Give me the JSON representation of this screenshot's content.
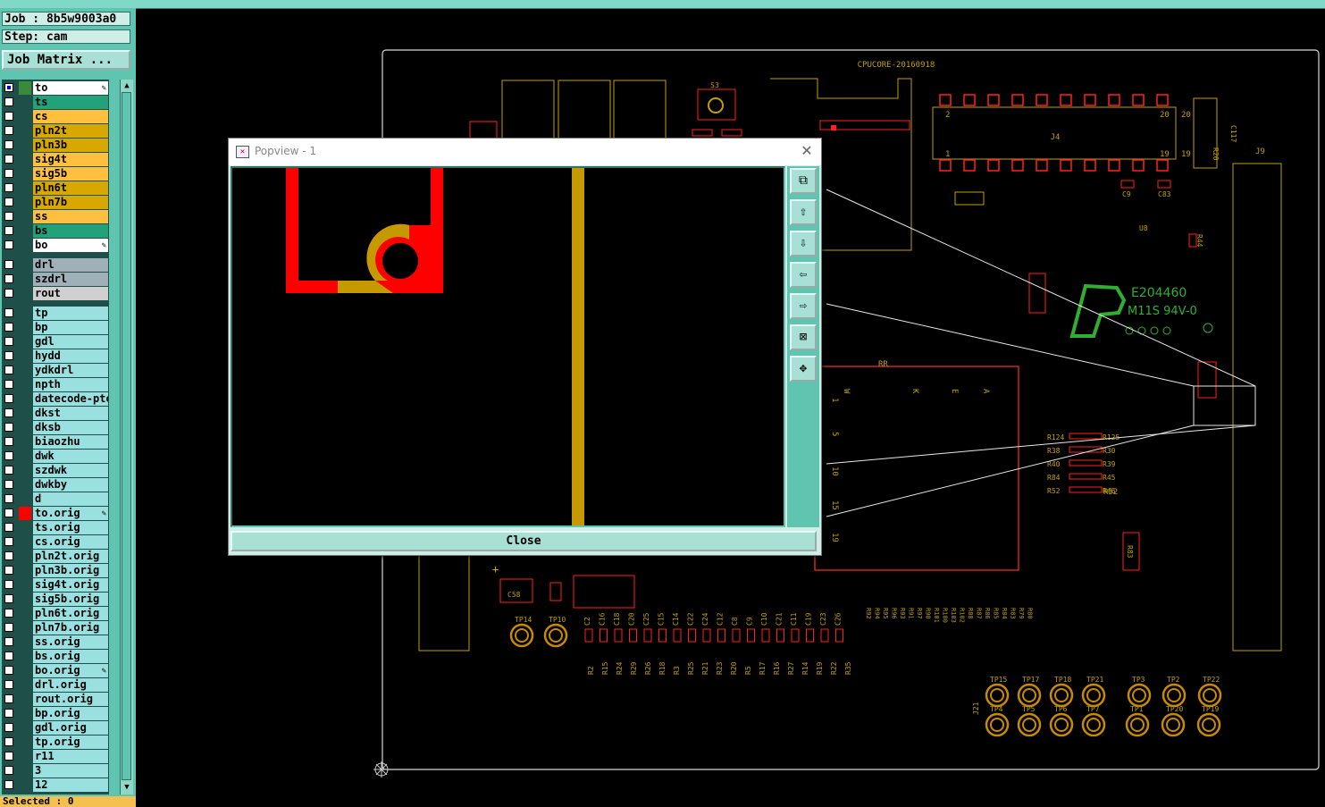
{
  "header": {
    "job": "Job : 8b5w9003a0",
    "step": "Step: cam",
    "job_matrix_button": "Job Matrix ..."
  },
  "layers": [
    {
      "name": "to",
      "color": "#ffffff",
      "swatch": "#3a8a3a",
      "checked": true,
      "editable": true
    },
    {
      "name": "ts",
      "color": "#22a17a",
      "checked": false
    },
    {
      "name": "cs",
      "color": "#ffc040",
      "checked": false
    },
    {
      "name": "pln2t",
      "color": "#d7a800",
      "checked": false
    },
    {
      "name": "pln3b",
      "color": "#d7a800",
      "checked": false
    },
    {
      "name": "sig4t",
      "color": "#ffc040",
      "checked": false
    },
    {
      "name": "sig5b",
      "color": "#ffc040",
      "checked": false
    },
    {
      "name": "pln6t",
      "color": "#d7a800",
      "checked": false
    },
    {
      "name": "pln7b",
      "color": "#d7a800",
      "checked": false
    },
    {
      "name": "ss",
      "color": "#ffc040",
      "checked": false
    },
    {
      "name": "bs",
      "color": "#22a17a",
      "checked": false
    },
    {
      "name": "bo",
      "color": "#ffffff",
      "checked": false,
      "editable": true
    },
    {
      "name": "drl",
      "color": "#9fb0b8",
      "checked": false,
      "gap": true
    },
    {
      "name": "szdrl",
      "color": "#9fb0b8",
      "checked": false
    },
    {
      "name": "rout",
      "color": "#d0d0d0",
      "checked": false
    },
    {
      "name": "tp",
      "color": "#9ae0e0",
      "checked": false,
      "gap": true
    },
    {
      "name": "bp",
      "color": "#9ae0e0",
      "checked": false
    },
    {
      "name": "gdl",
      "color": "#9ae0e0",
      "checked": false
    },
    {
      "name": "hydd",
      "color": "#9ae0e0",
      "checked": false
    },
    {
      "name": "ydkdrl",
      "color": "#9ae0e0",
      "checked": false
    },
    {
      "name": "npth",
      "color": "#9ae0e0",
      "checked": false
    },
    {
      "name": "datecode-pto",
      "color": "#9ae0e0",
      "checked": false
    },
    {
      "name": "dkst",
      "color": "#9ae0e0",
      "checked": false
    },
    {
      "name": "dksb",
      "color": "#9ae0e0",
      "checked": false
    },
    {
      "name": "biaozhu",
      "color": "#9ae0e0",
      "checked": false
    },
    {
      "name": "dwk",
      "color": "#9ae0e0",
      "checked": false
    },
    {
      "name": "szdwk",
      "color": "#9ae0e0",
      "checked": false
    },
    {
      "name": "dwkby",
      "color": "#9ae0e0",
      "checked": false
    },
    {
      "name": "d",
      "color": "#9ae0e0",
      "checked": false
    },
    {
      "name": "to.orig",
      "color": "#9ae0e0",
      "swatch": "#ff0000",
      "checked": false,
      "editable": true
    },
    {
      "name": "ts.orig",
      "color": "#9ae0e0",
      "checked": false
    },
    {
      "name": "cs.orig",
      "color": "#9ae0e0",
      "checked": false
    },
    {
      "name": "pln2t.orig",
      "color": "#9ae0e0",
      "checked": false
    },
    {
      "name": "pln3b.orig",
      "color": "#9ae0e0",
      "checked": false
    },
    {
      "name": "sig4t.orig",
      "color": "#9ae0e0",
      "checked": false
    },
    {
      "name": "sig5b.orig",
      "color": "#9ae0e0",
      "checked": false
    },
    {
      "name": "pln6t.orig",
      "color": "#9ae0e0",
      "checked": false
    },
    {
      "name": "pln7b.orig",
      "color": "#9ae0e0",
      "checked": false
    },
    {
      "name": "ss.orig",
      "color": "#9ae0e0",
      "checked": false
    },
    {
      "name": "bs.orig",
      "color": "#9ae0e0",
      "checked": false
    },
    {
      "name": "bo.orig",
      "color": "#9ae0e0",
      "checked": false,
      "editable": true
    },
    {
      "name": "drl.orig",
      "color": "#9ae0e0",
      "checked": false
    },
    {
      "name": "rout.orig",
      "color": "#9ae0e0",
      "checked": false
    },
    {
      "name": "bp.orig",
      "color": "#9ae0e0",
      "checked": false
    },
    {
      "name": "gdl.orig",
      "color": "#9ae0e0",
      "checked": false
    },
    {
      "name": "tp.orig",
      "color": "#9ae0e0",
      "checked": false
    },
    {
      "name": "r11",
      "color": "#9ae0e0",
      "checked": false
    },
    {
      "name": "3",
      "color": "#9ae0e0",
      "checked": false
    },
    {
      "name": "12",
      "color": "#9ae0e0",
      "checked": false
    }
  ],
  "status": {
    "selected": "Selected : 0"
  },
  "popview": {
    "title": "Popview - 1",
    "close_label": "Close",
    "tools": [
      "zoom-window-icon",
      "pan-up-icon",
      "pan-down-icon",
      "pan-left-icon",
      "pan-right-icon",
      "zoom-fit-icon",
      "zoom-center-icon"
    ]
  },
  "board": {
    "title_text": "CPUCORE-20160918",
    "ul_line1": "E204460",
    "ul_line2": "M11S 94V-0",
    "refs": {
      "s3": "S3",
      "j4": "J4",
      "j9": "J9",
      "j21": "J21",
      "u8": "U8",
      "r44": "R44",
      "c8": "C8",
      "c9": "C9",
      "r52": "R52",
      "c58": "C58",
      "r83": "R83",
      "r8": "R8",
      "c83": "C83",
      "c117": "C117",
      "r20": "R20"
    },
    "pins": {
      "j4_tl": "2",
      "j4_tr": "20",
      "j4_bl": "1",
      "j4_br": "19",
      "j4_tr_out": "20",
      "j4_br_out": "19"
    },
    "testpoints": [
      "TP14",
      "TP10",
      "TP15",
      "TP17",
      "TP18",
      "TP21",
      "TP3",
      "TP2",
      "TP22",
      "TP4",
      "TP5",
      "TP6",
      "TP7",
      "TP1",
      "TP20",
      "TP19"
    ],
    "bottom_caps": [
      "C2",
      "C16",
      "C18",
      "C20",
      "C25",
      "C15",
      "C14",
      "C22",
      "C24",
      "C12",
      "C8",
      "C9",
      "C10",
      "C21",
      "C11",
      "C19",
      "C23",
      "C26"
    ],
    "bottom_res": [
      "R2",
      "R15",
      "R24",
      "R29",
      "R26",
      "R18",
      "R3",
      "R25",
      "R21",
      "R23",
      "R20",
      "R5",
      "R17",
      "R16",
      "R27",
      "R14",
      "R19",
      "R22",
      "R35"
    ],
    "side_res": [
      "R92",
      "R94",
      "R95",
      "R96",
      "R93",
      "R91",
      "R97",
      "R90",
      "R101",
      "R100",
      "R103",
      "R102",
      "R88",
      "R87",
      "R86",
      "R85",
      "R84",
      "R83",
      "R79",
      "R80"
    ],
    "mid_res": [
      "R124",
      "R125",
      "R38",
      "R30",
      "R40",
      "R39",
      "R84",
      "R45",
      "R52",
      "R46"
    ],
    "conn_labels": [
      "W",
      "K",
      "E",
      "A",
      "1",
      "5",
      "10",
      "15",
      "19",
      "RR"
    ]
  }
}
